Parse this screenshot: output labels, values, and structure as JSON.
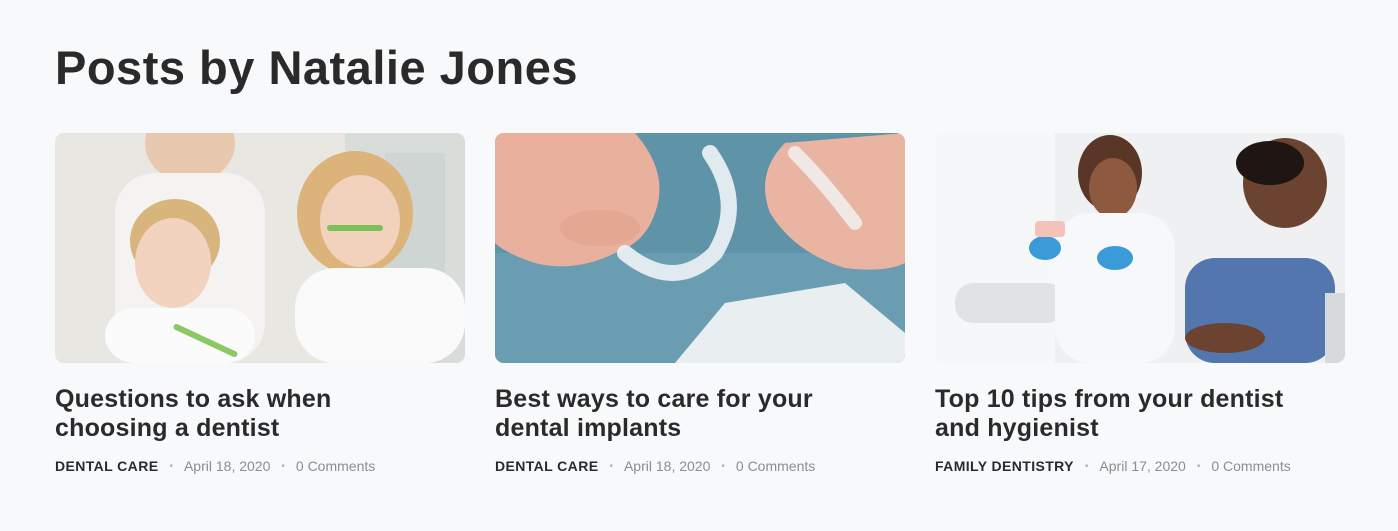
{
  "page": {
    "title": "Posts by Natalie Jones"
  },
  "posts": [
    {
      "title": "Questions to ask when choosing a dentist",
      "category": "DENTAL CARE",
      "date": "April 18, 2020",
      "comments": "0 Comments",
      "image": "family-brushing-teeth-photo"
    },
    {
      "title": "Best ways to care for your dental implants",
      "category": "DENTAL CARE",
      "date": "April 18, 2020",
      "comments": "0 Comments",
      "image": "clear-aligners-photo"
    },
    {
      "title": "Top 10 tips from your dentist and hygienist",
      "category": "FAMILY DENTISTRY",
      "date": "April 17, 2020",
      "comments": "0 Comments",
      "image": "dentist-with-patient-photo"
    }
  ],
  "meta": {
    "separator": "•"
  },
  "colors": {
    "background": "#f8f9fb",
    "heading": "#2a2a2a",
    "meta_text": "#8a8d93"
  }
}
